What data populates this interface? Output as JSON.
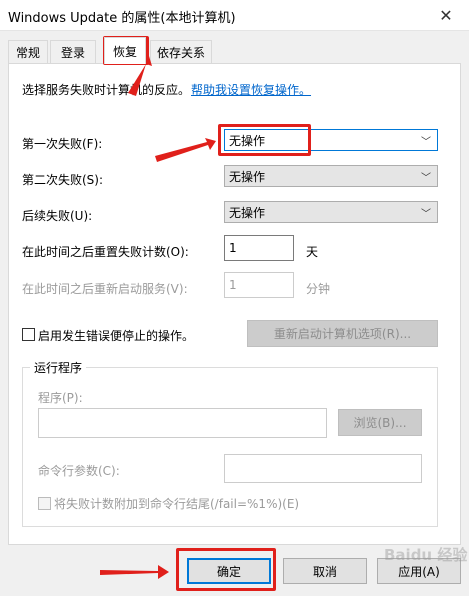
{
  "window": {
    "title": "Windows Update 的属性(本地计算机)"
  },
  "tabs": [
    {
      "label": "常规"
    },
    {
      "label": "登录"
    },
    {
      "label": "恢复"
    },
    {
      "label": "依存关系"
    }
  ],
  "recovery": {
    "intro": "选择服务失败时计算机的反应。",
    "help_link": "帮助我设置恢复操作。",
    "first_failure_label": "第一次失败(F):",
    "first_failure_value": "无操作",
    "second_failure_label": "第二次失败(S):",
    "second_failure_value": "无操作",
    "subsequent_label": "后续失败(U):",
    "subsequent_value": "无操作",
    "reset_label": "在此时间之后重置失败计数(O):",
    "reset_value": "1",
    "reset_unit": "天",
    "restart_label": "在此时间之后重新启动服务(V):",
    "restart_value": "1",
    "restart_unit": "分钟",
    "enable_actions_label": "启用发生错误便停止的操作。",
    "restart_options_button": "重新启动计算机选项(R)...",
    "run_program_group": "运行程序",
    "program_label": "程序(P):",
    "program_value": "",
    "browse_button": "浏览(B)...",
    "cmd_args_label": "命令行参数(C):",
    "cmd_args_value": "",
    "append_fail_label": "将失败计数附加到命令行结尾(/fail=%1%)(E)"
  },
  "footer": {
    "ok_button": "确定",
    "cancel_button": "取消",
    "apply_button": "应用(A)"
  },
  "watermark": "Baidu 经验",
  "colors": {
    "annotation_red": "#e0201b",
    "focus_blue": "#0078d7",
    "link_blue": "#0066cc"
  }
}
